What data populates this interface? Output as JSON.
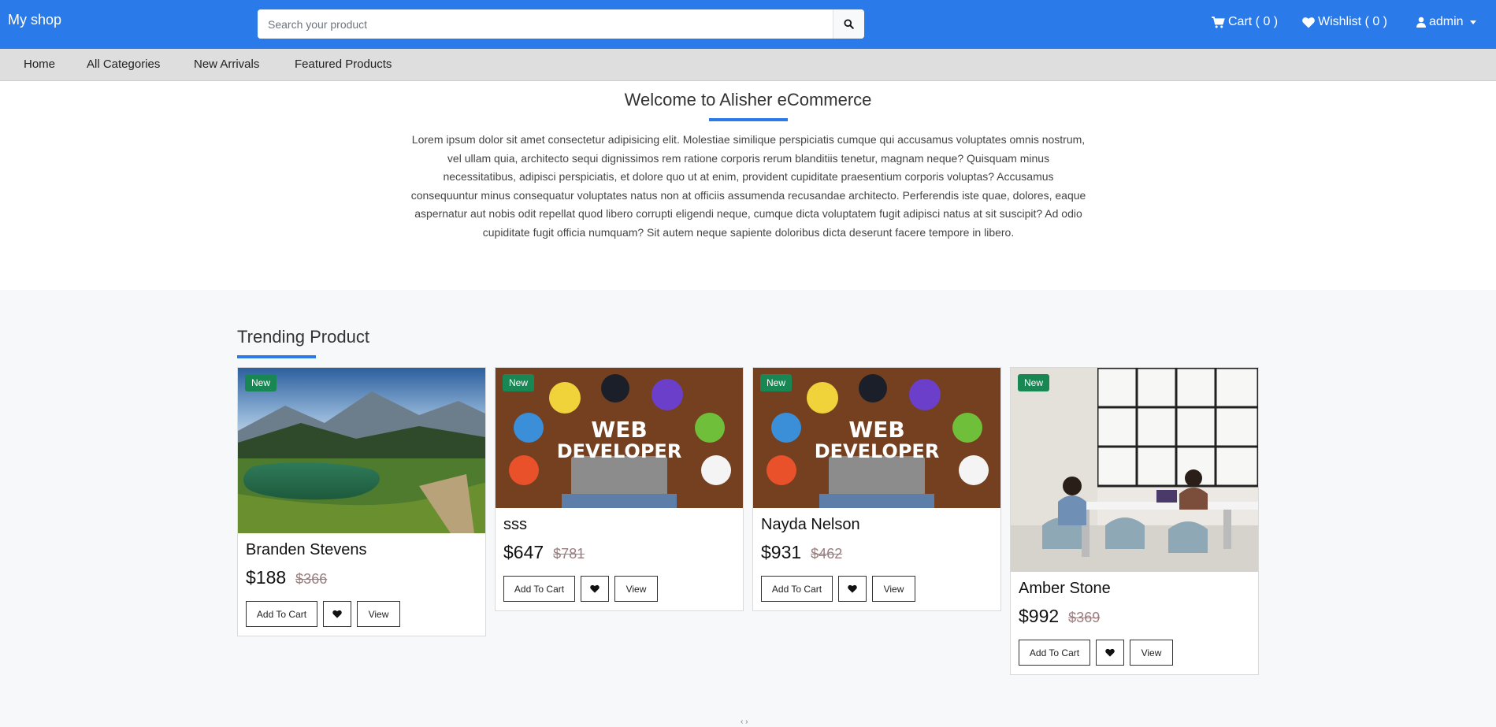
{
  "header": {
    "brand": "My shop",
    "search_placeholder": "Search your product",
    "cart_label": "Cart ( 0 )",
    "wishlist_label": "Wishlist ( 0 )",
    "user_label": "admin"
  },
  "subnav": {
    "items": [
      "Home",
      "All Categories",
      "New Arrivals",
      "Featured Products"
    ]
  },
  "welcome": {
    "title": "Welcome to Alisher eCommerce",
    "text": "Lorem ipsum dolor sit amet consectetur adipisicing elit. Molestiae similique perspiciatis cumque qui accusamus voluptates omnis nostrum, vel ullam quia, architecto sequi dignissimos rem ratione corporis rerum blanditiis tenetur, magnam neque? Quisquam minus necessitatibus, adipisci perspiciatis, et dolore quo ut at enim, provident cupiditate praesentium corporis voluptas? Accusamus consequuntur minus consequatur voluptates natus non at officiis assumenda recusandae architecto. Perferendis iste quae, dolores, eaque aspernatur aut nobis odit repellat quod libero corrupti eligendi neque, cumque dicta voluptatem fugit adipisci natus at sit suscipit? Ad odio cupiditate fugit officia numquam? Sit autem neque sapiente doloribus dicta deserunt facere tempore in libero."
  },
  "trending": {
    "title": "Trending Product",
    "products": [
      {
        "badge": "New",
        "name": "Branden Stevens",
        "price": "$188",
        "old_price": "$366",
        "add_label": "Add To Cart",
        "view_label": "View",
        "image": "mountain-lake"
      },
      {
        "badge": "New",
        "name": "sss",
        "price": "$647",
        "old_price": "$781",
        "add_label": "Add To Cart",
        "view_label": "View",
        "image": "web-developer",
        "image_text": [
          "WEB",
          "DEVELOPER"
        ]
      },
      {
        "badge": "New",
        "name": "Nayda Nelson",
        "price": "$931",
        "old_price": "$462",
        "add_label": "Add To Cart",
        "view_label": "View",
        "image": "web-developer",
        "image_text": [
          "WEB",
          "DEVELOPER"
        ]
      },
      {
        "badge": "New",
        "name": "Amber Stone",
        "price": "$992",
        "old_price": "$369",
        "add_label": "Add To Cart",
        "view_label": "View",
        "image": "office-meeting"
      }
    ]
  },
  "pager": "‹ ›",
  "colors": {
    "primary": "#2b7ae9",
    "badge": "#198754",
    "subnav": "#dedede"
  }
}
